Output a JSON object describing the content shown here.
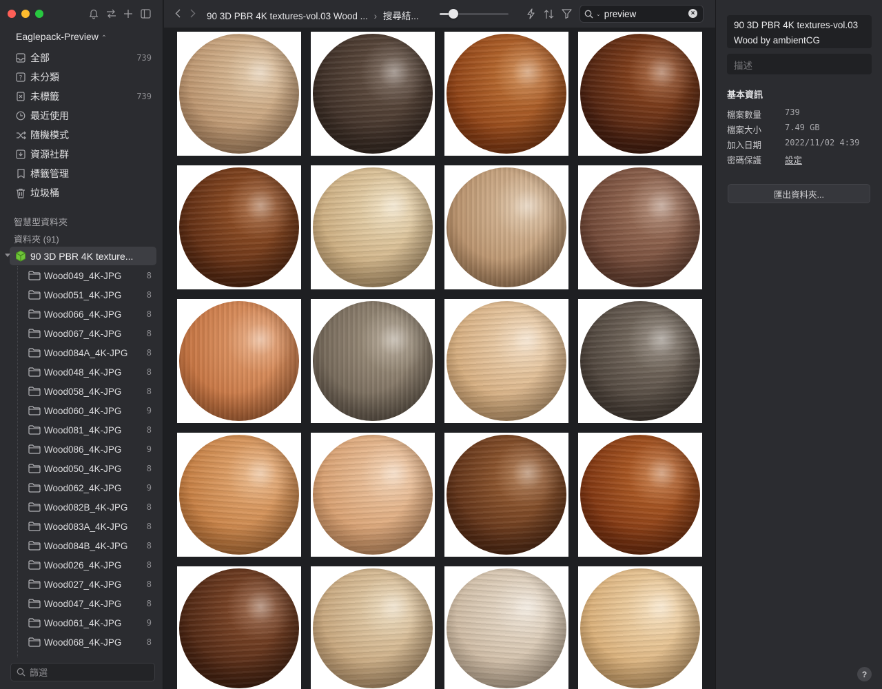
{
  "sidebar": {
    "library_title": "Eaglepack-Preview",
    "nav": [
      {
        "label": "全部",
        "count": "739",
        "icon": "inbox-icon"
      },
      {
        "label": "未分類",
        "count": "",
        "icon": "question-icon"
      },
      {
        "label": "未標籤",
        "count": "739",
        "icon": "untagged-icon"
      },
      {
        "label": "最近使用",
        "count": "",
        "icon": "clock-icon"
      },
      {
        "label": "隨機模式",
        "count": "",
        "icon": "shuffle-icon"
      },
      {
        "label": "資源社群",
        "count": "",
        "icon": "community-icon"
      },
      {
        "label": "標籤管理",
        "count": "",
        "icon": "tag-icon"
      },
      {
        "label": "垃圾桶",
        "count": "",
        "icon": "trash-icon"
      }
    ],
    "smart_folders_label": "智慧型資料夾",
    "folders_label": "資料夾 (91)",
    "active_folder": "90 3D PBR 4K texture...",
    "subfolders": [
      {
        "name": "Wood049_4K-JPG",
        "count": "8"
      },
      {
        "name": "Wood051_4K-JPG",
        "count": "8"
      },
      {
        "name": "Wood066_4K-JPG",
        "count": "8"
      },
      {
        "name": "Wood067_4K-JPG",
        "count": "8"
      },
      {
        "name": "Wood084A_4K-JPG",
        "count": "8"
      },
      {
        "name": "Wood048_4K-JPG",
        "count": "8"
      },
      {
        "name": "Wood058_4K-JPG",
        "count": "8"
      },
      {
        "name": "Wood060_4K-JPG",
        "count": "9"
      },
      {
        "name": "Wood081_4K-JPG",
        "count": "8"
      },
      {
        "name": "Wood086_4K-JPG",
        "count": "9"
      },
      {
        "name": "Wood050_4K-JPG",
        "count": "8"
      },
      {
        "name": "Wood062_4K-JPG",
        "count": "9"
      },
      {
        "name": "Wood082B_4K-JPG",
        "count": "8"
      },
      {
        "name": "Wood083A_4K-JPG",
        "count": "8"
      },
      {
        "name": "Wood084B_4K-JPG",
        "count": "8"
      },
      {
        "name": "Wood026_4K-JPG",
        "count": "8"
      },
      {
        "name": "Wood027_4K-JPG",
        "count": "8"
      },
      {
        "name": "Wood047_4K-JPG",
        "count": "8"
      },
      {
        "name": "Wood061_4K-JPG",
        "count": "9"
      },
      {
        "name": "Wood068_4K-JPG",
        "count": "8"
      }
    ],
    "filter_placeholder": "篩選"
  },
  "toolbar": {
    "breadcrumb_folder": "90 3D PBR 4K textures-vol.03 Wood ...",
    "breadcrumb_sep": "›",
    "breadcrumb_current": "搜尋結...",
    "thumbnail_size": 0.2,
    "search_value": "preview"
  },
  "grid": {
    "colors": [
      [
        "#b8906a",
        "#e0c4a0"
      ],
      [
        "#3a2c24",
        "#6a5648"
      ],
      [
        "#8a3e14",
        "#c87a3a"
      ],
      [
        "#4a2010",
        "#9a4e22"
      ],
      [
        "#5a2a12",
        "#a05a2c"
      ],
      [
        "#c8a87a",
        "#eedcb8"
      ],
      [
        "#b48c66",
        "#dcc0a0"
      ],
      [
        "#6a4232",
        "#a67a62"
      ],
      [
        "#c2703e",
        "#e6a070"
      ],
      [
        "#6e6254",
        "#a89a86"
      ],
      [
        "#d2a878",
        "#f2d8b8"
      ],
      [
        "#4a4038",
        "#857a6e"
      ],
      [
        "#c27a3e",
        "#eab07a"
      ],
      [
        "#d49a6a",
        "#f2cca8"
      ],
      [
        "#5a2e16",
        "#a4683a"
      ],
      [
        "#7a3210",
        "#c06a2e"
      ],
      [
        "#4a2412",
        "#8e5230"
      ],
      [
        "#c2a076",
        "#ead6b4"
      ],
      [
        "#cab69e",
        "#ece0d0"
      ],
      [
        "#d6aa72",
        "#f6dcb4"
      ]
    ]
  },
  "inspector": {
    "title": "90 3D PBR 4K textures-vol.03 Wood by ambientCG",
    "description_placeholder": "描述",
    "heading": "基本資訊",
    "rows": [
      {
        "label": "檔案數量",
        "value": "739"
      },
      {
        "label": "檔案大小",
        "value": "7.49 GB"
      },
      {
        "label": "加入日期",
        "value": "2022/11/02 4:39"
      },
      {
        "label": "密碼保護",
        "value": "設定"
      }
    ],
    "export_label": "匯出資料夾...",
    "help_label": "?"
  }
}
